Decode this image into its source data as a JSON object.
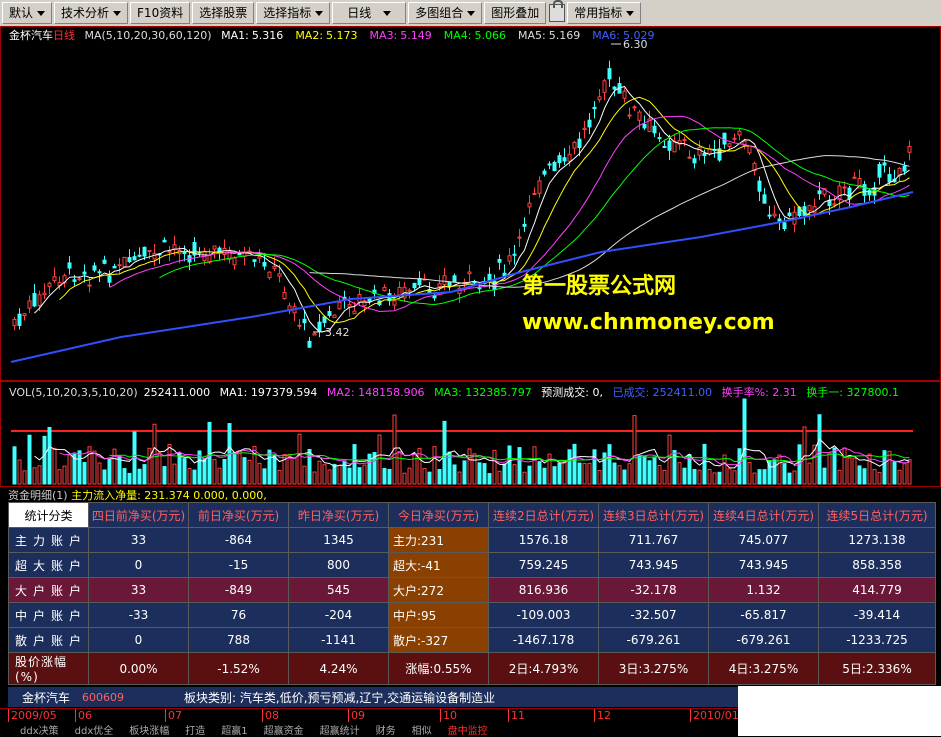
{
  "toolbar": {
    "items": [
      {
        "label": "默认"
      },
      {
        "label": "技术分析"
      },
      {
        "label": "F10资料"
      },
      {
        "label": "选择股票"
      },
      {
        "label": "选择指标"
      },
      {
        "label": "日线"
      },
      {
        "label": "多图组合"
      },
      {
        "label": "图形叠加"
      },
      {
        "label": "常用指标"
      }
    ]
  },
  "main_chart": {
    "stock_name": "金杯汽车",
    "period": "日线",
    "ma_params": "MA(5,10,20,30,60,120)",
    "ma": [
      {
        "label": "MA1:",
        "value": "5.316",
        "color": "#ffffff"
      },
      {
        "label": "MA2:",
        "value": "5.173",
        "color": "#ffff00"
      },
      {
        "label": "MA3:",
        "value": "5.149",
        "color": "#ff40ff"
      },
      {
        "label": "MA4:",
        "value": "5.066",
        "color": "#00ff00"
      },
      {
        "label": "MA5:",
        "value": "5.169",
        "color": "#dddddd"
      },
      {
        "label": "MA6:",
        "value": "5.029",
        "color": "#4060ff"
      }
    ],
    "high_label": "6.30",
    "low_label": "3.42"
  },
  "watermark": {
    "line1": "第一股票公式网",
    "line2": "www.chnmoney.com"
  },
  "volume_chart": {
    "params": "VOL(5,10,20,3,5,10,20)",
    "vol": "252411.000",
    "ma1": "MA1: 197379.594",
    "ma2": "MA2: 148158.906",
    "ma3": "MA3: 132385.797",
    "forecast": "预测成交: 0,",
    "done": "已成交: 252411.00",
    "turnover": "换手率%: 2.31",
    "turnover1": "换手一: 327800.1"
  },
  "fund_flow": {
    "title": "资金明细(1)",
    "main_inflow": "主力流入净量: 231.374",
    "extra": "0.000, 0.000,",
    "headers": [
      "统计分类",
      "四日前净买(万元)",
      "前日净买(万元)",
      "昨日净买(万元)",
      "今日净买(万元)",
      "连续2日总计(万元)",
      "连续3日总计(万元)",
      "连续4日总计(万元)",
      "连续5日总计(万元)"
    ],
    "rows": [
      {
        "label": "主力账户",
        "cells": [
          "33",
          "-864",
          "1345",
          "主力:231",
          "1576.18",
          "711.767",
          "745.077",
          "1273.138"
        ]
      },
      {
        "label": "超大账户",
        "cells": [
          "0",
          "-15",
          "800",
          "超大:-41",
          "759.245",
          "743.945",
          "743.945",
          "858.358"
        ]
      },
      {
        "label": "大户账户",
        "cells": [
          "33",
          "-849",
          "545",
          "大户:272",
          "816.936",
          "-32.178",
          "1.132",
          "414.779"
        ]
      },
      {
        "label": "中户账户",
        "cells": [
          "-33",
          "76",
          "-204",
          "中户:95",
          "-109.003",
          "-32.507",
          "-65.817",
          "-39.414"
        ]
      },
      {
        "label": "散户账户",
        "cells": [
          "0",
          "788",
          "-1141",
          "散户:-327",
          "-1467.178",
          "-679.261",
          "-679.261",
          "-1233.725"
        ]
      }
    ],
    "pct_row": {
      "label": "股价涨幅(%)",
      "cells": [
        "0.00%",
        "-1.52%",
        "4.24%",
        "涨幅:0.55%",
        "2日:4.793%",
        "3日:3.275%",
        "4日:3.275%",
        "5日:2.336%"
      ]
    }
  },
  "footer": {
    "name": "金杯汽车",
    "code": "600609",
    "sector": "板块类别: 汽车类,低价,预亏预减,辽宁,交通运输设备制造业"
  },
  "time_axis": [
    "2009/05",
    "06",
    "07",
    "08",
    "09",
    "10",
    "11",
    "12",
    "2010/01"
  ],
  "bottom_tabs": [
    "ddx决策",
    "ddx优全",
    "板块涨幅",
    "打造",
    "超赢1",
    "超赢资金",
    "超赢统计",
    "财务",
    "相似",
    "盘中监控"
  ]
}
